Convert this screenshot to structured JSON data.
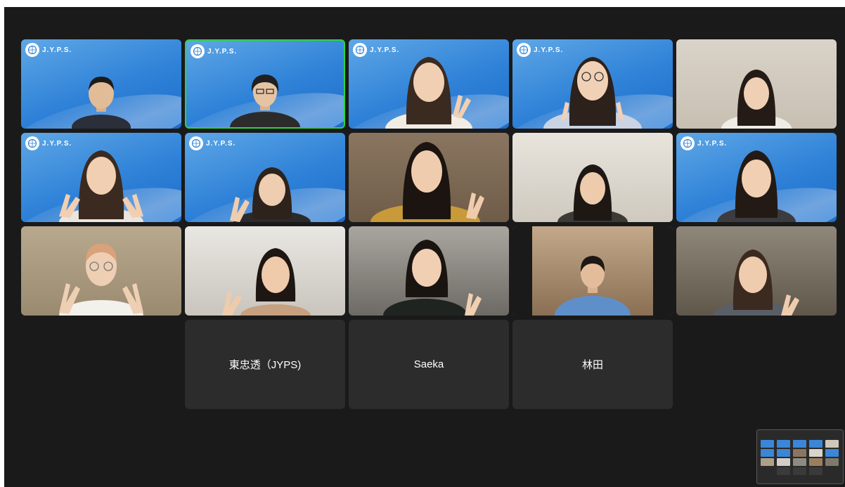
{
  "meeting": {
    "view": "gallery",
    "background_color": "#1a1a1a",
    "active_speaker_color": "#2ed142"
  },
  "branding": {
    "logo_text": "J.Y.P.S.",
    "logo_icon": "globe-laurel-icon",
    "brand_color": "#2f82d8"
  },
  "participants": [
    {
      "row": 1,
      "col": 1,
      "video": true,
      "background": "jyps",
      "speaking": false
    },
    {
      "row": 1,
      "col": 2,
      "video": true,
      "background": "jyps",
      "speaking": true
    },
    {
      "row": 1,
      "col": 3,
      "video": true,
      "background": "jyps",
      "speaking": false
    },
    {
      "row": 1,
      "col": 4,
      "video": true,
      "background": "jyps",
      "speaking": false
    },
    {
      "row": 1,
      "col": 5,
      "video": true,
      "background": "room",
      "speaking": false
    },
    {
      "row": 2,
      "col": 1,
      "video": true,
      "background": "jyps",
      "speaking": false
    },
    {
      "row": 2,
      "col": 2,
      "video": true,
      "background": "jyps",
      "speaking": false
    },
    {
      "row": 2,
      "col": 3,
      "video": true,
      "background": "room",
      "speaking": false
    },
    {
      "row": 2,
      "col": 4,
      "video": true,
      "background": "room",
      "speaking": false
    },
    {
      "row": 2,
      "col": 5,
      "video": true,
      "background": "jyps",
      "speaking": false
    },
    {
      "row": 3,
      "col": 1,
      "video": true,
      "background": "room",
      "speaking": false
    },
    {
      "row": 3,
      "col": 2,
      "video": true,
      "background": "room",
      "speaking": false
    },
    {
      "row": 3,
      "col": 3,
      "video": true,
      "background": "room",
      "speaking": false
    },
    {
      "row": 3,
      "col": 4,
      "video": true,
      "background": "room",
      "speaking": false
    },
    {
      "row": 3,
      "col": 5,
      "video": true,
      "background": "room",
      "speaking": false
    }
  ],
  "camera_off_participants": [
    {
      "name": "東忠透（JYPS)"
    },
    {
      "name": "Saeka"
    },
    {
      "name": "林田"
    }
  ],
  "self_view": {
    "visible": true
  }
}
